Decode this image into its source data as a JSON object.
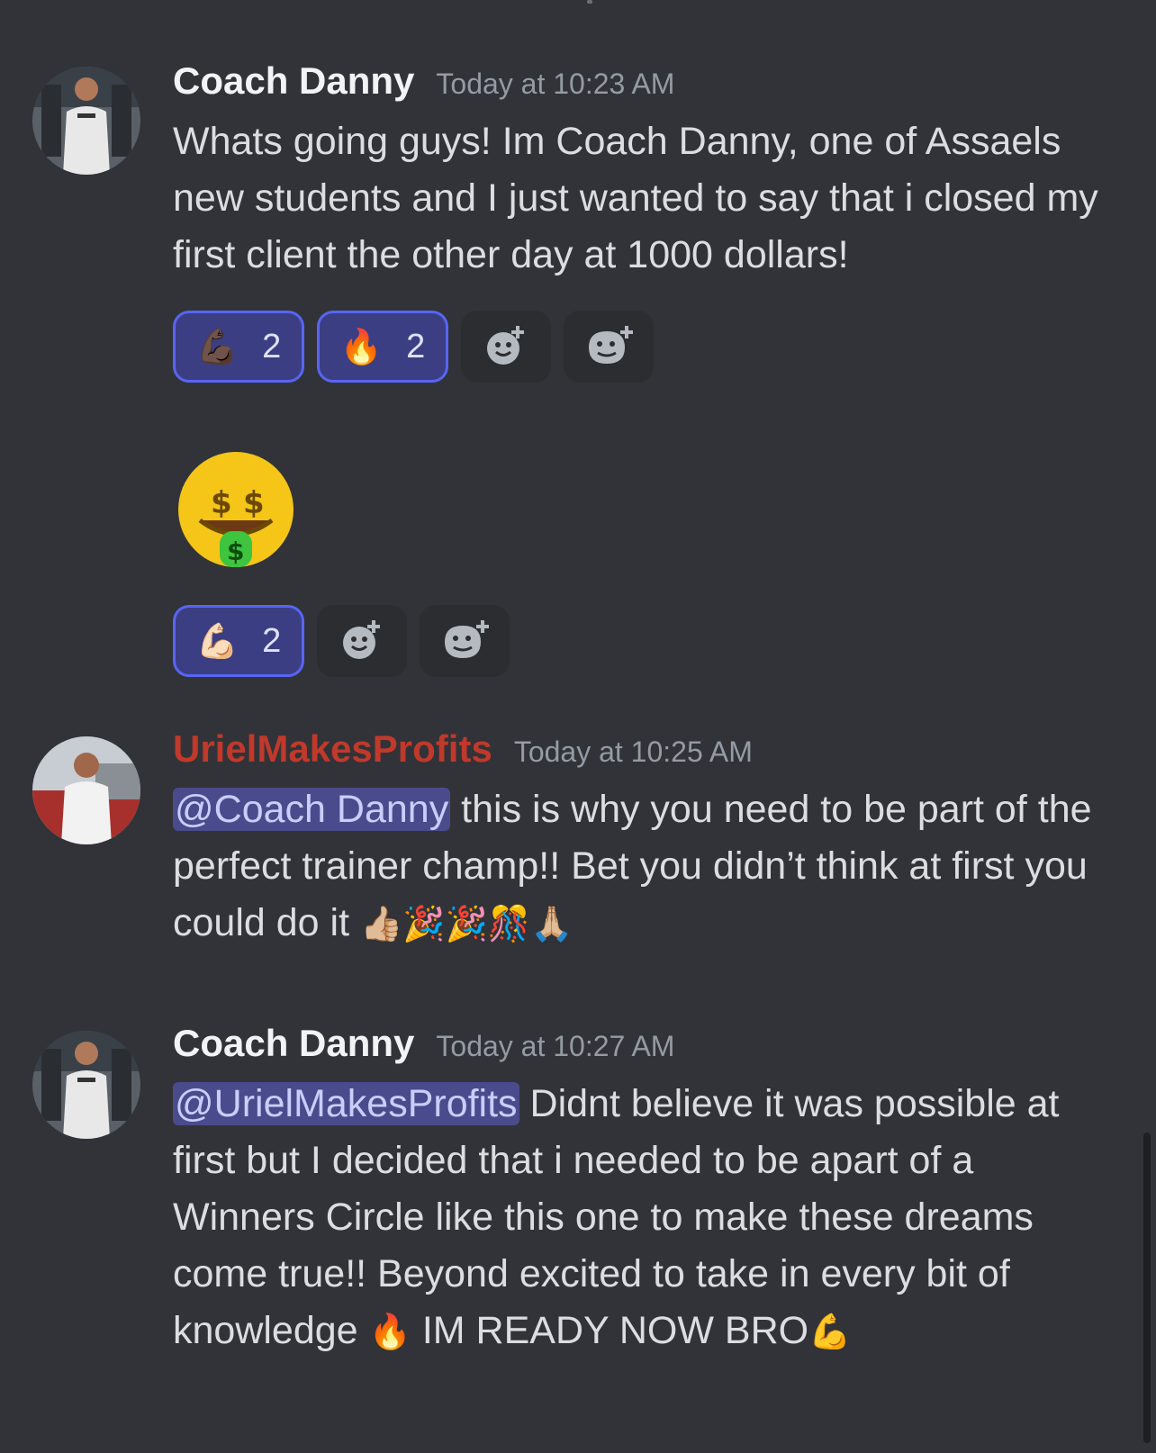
{
  "messages": [
    {
      "author": "Coach Danny",
      "timestamp": "Today at 10:23 AM",
      "text": "Whats going guys! Im Coach Danny, one of Assaels new students and I just wanted to say that i closed my first client the other day at 1000 dollars!",
      "reactions": [
        {
          "emoji": "💪🏿",
          "count": "2",
          "icon": "flexed-biceps-dark-icon"
        },
        {
          "emoji": "🔥",
          "count": "2",
          "icon": "fire-icon"
        }
      ]
    },
    {
      "author": "Coach Danny",
      "emoji_message": "🤑",
      "reactions": [
        {
          "emoji": "💪🏻",
          "count": "2",
          "icon": "flexed-biceps-light-icon"
        }
      ]
    },
    {
      "author": "UrielMakesProfits",
      "timestamp": "Today at 10:25 AM",
      "mention": "@Coach Danny",
      "text": " this is why you need to be part of the perfect  trainer champ!! Bet you didn’t think at first you could do it ",
      "emojis": "👍🏼🎉🎉🎊🙏🏼"
    },
    {
      "author": "Coach Danny",
      "timestamp": "Today at 10:27 AM",
      "mention": "@UrielMakesProfits",
      "text": " Didnt believe it was possible at first but I decided that i needed to be apart of a Winners Circle like this one to make these dreams come true!! Beyond excited to take in every bit of knowledge ",
      "emoji_1": "🔥",
      "text_2": "  IM READY NOW BRO",
      "emoji_2": "💪"
    }
  ],
  "colors": {
    "background": "#313338",
    "reaction_active_border": "#5865f2",
    "mention_bg": "#4a4b8c",
    "uriel_name": "#c0392b"
  }
}
